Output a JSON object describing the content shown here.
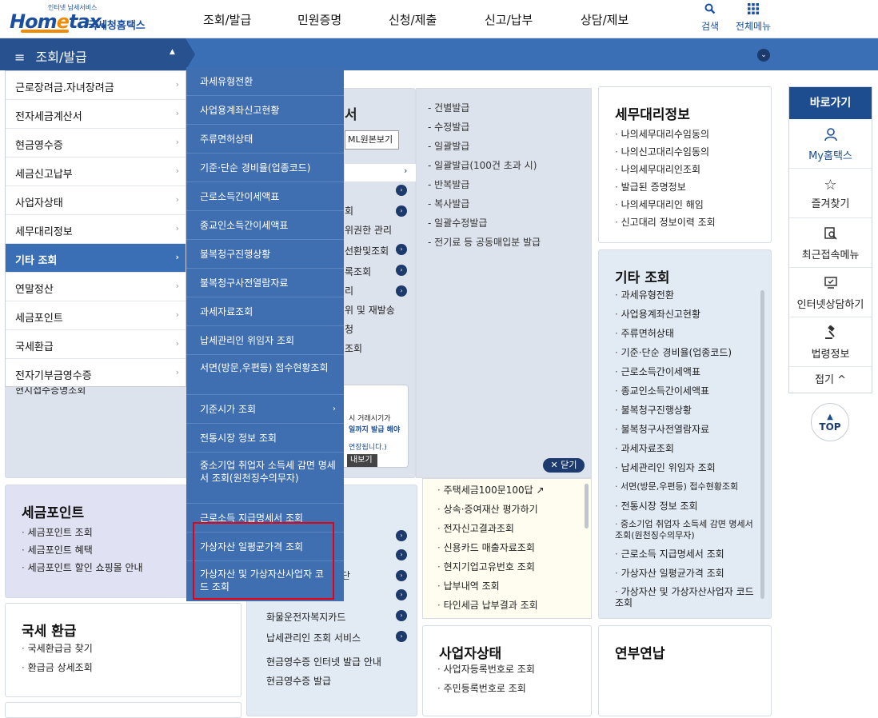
{
  "header": {
    "logo_sub": "인터넷 납세서비스",
    "logo_main_a": "Hom",
    "logo_main_e": "e",
    "logo_main_b": "tax.",
    "logo_kr": "국세청홈택스",
    "nav": [
      "조회/발급",
      "민원증명",
      "신청/제출",
      "신고/납부",
      "상담/제보"
    ],
    "search_label": "검색",
    "all_menu_label": "전체메뉴"
  },
  "menubar": {
    "current": "조회/발급"
  },
  "left_menu": [
    "근로장려금.자녀장려금",
    "전자세금계산서",
    "현금영수증",
    "세금신고납부",
    "사업자상태",
    "세무대리정보",
    "기타 조회",
    "연말정산",
    "세금포인트",
    "국세환급",
    "전자기부금영수증"
  ],
  "left_menu_active": "기타 조회",
  "sub_menu": [
    "과세유형전환",
    "사업용계좌신고현황",
    "주류면허상태",
    "기준·단순 경비율(업종코드)",
    "근로소득간이세액표",
    "종교인소득간이세액표",
    "불복청구진행상황",
    "불복청구사전열람자료",
    "과세자료조회",
    "납세관리인 위임자 조회",
    "서면(방문,우편등) 접수현황조회",
    "기준시가 조회",
    "전통시장 정보 조회",
    "중소기업 취업자 소득세 감면 명세서 조회(원천징수의무자)",
    "근로소득 지급명세서 조회",
    "가상자산 일평균가격 조회",
    "가상자산 및 가상자산사업자 코드 조회"
  ],
  "partial_card": {
    "title_fragment": "서",
    "xml_button": "ML원본보기",
    "fragments": [
      "회",
      "위권한 관리",
      "선환및조회",
      "록조회",
      "리",
      "위 및 재발송",
      "청",
      "조회"
    ],
    "promo_lines": [
      "시 거래시기가",
      "일까지 발급 해야",
      "연장됩니다.)"
    ],
    "promo_button": "내보기"
  },
  "issue_panel": {
    "items": [
      "건별발급",
      "수정발급",
      "일괄발급",
      "일괄발급(100건 초과 시)",
      "반복발급",
      "복사발급",
      "일괄수정발급",
      "전기료 등 공동매입분 발급"
    ],
    "close_label": "닫기"
  },
  "tax_agent_card": {
    "title": "세무대리정보",
    "items": [
      "나의세무대리수임동의",
      "나의신고대리수임동의",
      "나의세무대리인조회",
      "발급된 증명정보",
      "나의세무대리인 해임",
      "신고대리 정보이력 조회"
    ]
  },
  "other_card": {
    "title": "기타 조회",
    "items": [
      "과세유형전환",
      "사업용계좌신고현황",
      "주류면허상태",
      "기준·단순 경비율(업종코드)",
      "근로소득간이세액표",
      "종교인소득간이세액표",
      "불복청구진행상황",
      "불복청구사전열람자료",
      "과세자료조회",
      "납세관리인 위임자 조회",
      "서면(방문,우편등) 접수현황조회",
      "전통시장 정보 조회",
      "중소기업 취업자 소득세 감면 명세서 조회(원천징수의무자)",
      "근로소득 지급명세서 조회",
      "가상자산 일평균가격 조회",
      "가상자산 및 가상자산사업자 코드 조회"
    ]
  },
  "cash_fragment": "현지접수증명조회",
  "tax_point": {
    "title": "세금포인트",
    "items": [
      "세금포인트 조회",
      "세금포인트 혜택",
      "세금포인트 할인 쇼핑몰 안내"
    ]
  },
  "refund": {
    "title": "국세 환급",
    "items": [
      "국세환급금 찾기",
      "환급금 상세조회"
    ]
  },
  "middle_lower": {
    "fragment": "단",
    "items": [
      "화물운전자복지카드",
      "납세관리인 조회 서비스"
    ],
    "links": [
      "현금영수증 인터넷 발급 안내",
      "현금영수증 발급"
    ]
  },
  "cream_card": {
    "items": [
      "주택세금100문100답",
      "상속·증여재산 평가하기",
      "전자신고결과조회",
      "신용카드 매출자료조회",
      "현지기업고유번호 조회",
      "납부내역 조회",
      "타인세금 납부결과 조회"
    ]
  },
  "biz_status": {
    "title": "사업자상태",
    "items": [
      "사업자등록번호로 조회",
      "주민등록번호로 조회"
    ]
  },
  "year_end": {
    "title": "연부연납"
  },
  "quick": {
    "title": "바로가기",
    "items": [
      "My홈택스",
      "즐겨찾기",
      "최근접속메뉴",
      "인터넷상담하기",
      "법령정보"
    ],
    "fold": "접기",
    "top": "TOP"
  },
  "colors": {
    "primary": "#1d4d8f",
    "bar": "#3a6fb5",
    "submenu": "#3f6fb0",
    "highlight": "#e60012",
    "accent": "#f08a00"
  }
}
